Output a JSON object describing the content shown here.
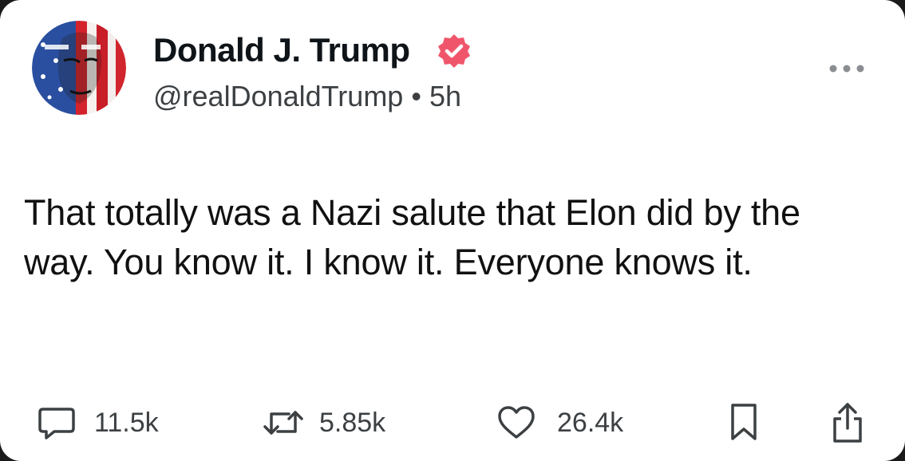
{
  "post": {
    "author_name": "Donald J. Trump",
    "handle": "@realDonaldTrump",
    "separator": "•",
    "time_ago": "5h",
    "text": "That totally was a Nazi salute that Elon did by the way. You know it. I know it. Everyone knows it."
  },
  "actions": {
    "replies": "11.5k",
    "reposts": "5.85k",
    "likes": "26.4k"
  },
  "icons": {
    "verified": "verified-badge-icon",
    "more": "more-horizontal-icon",
    "reply": "comment-icon",
    "repost": "repost-icon",
    "like": "heart-icon",
    "bookmark": "bookmark-icon",
    "share": "share-icon"
  },
  "colors": {
    "verified_badge": "#f0566b",
    "text": "#0f1419",
    "muted": "#3c4043",
    "background": "#ffffff"
  }
}
